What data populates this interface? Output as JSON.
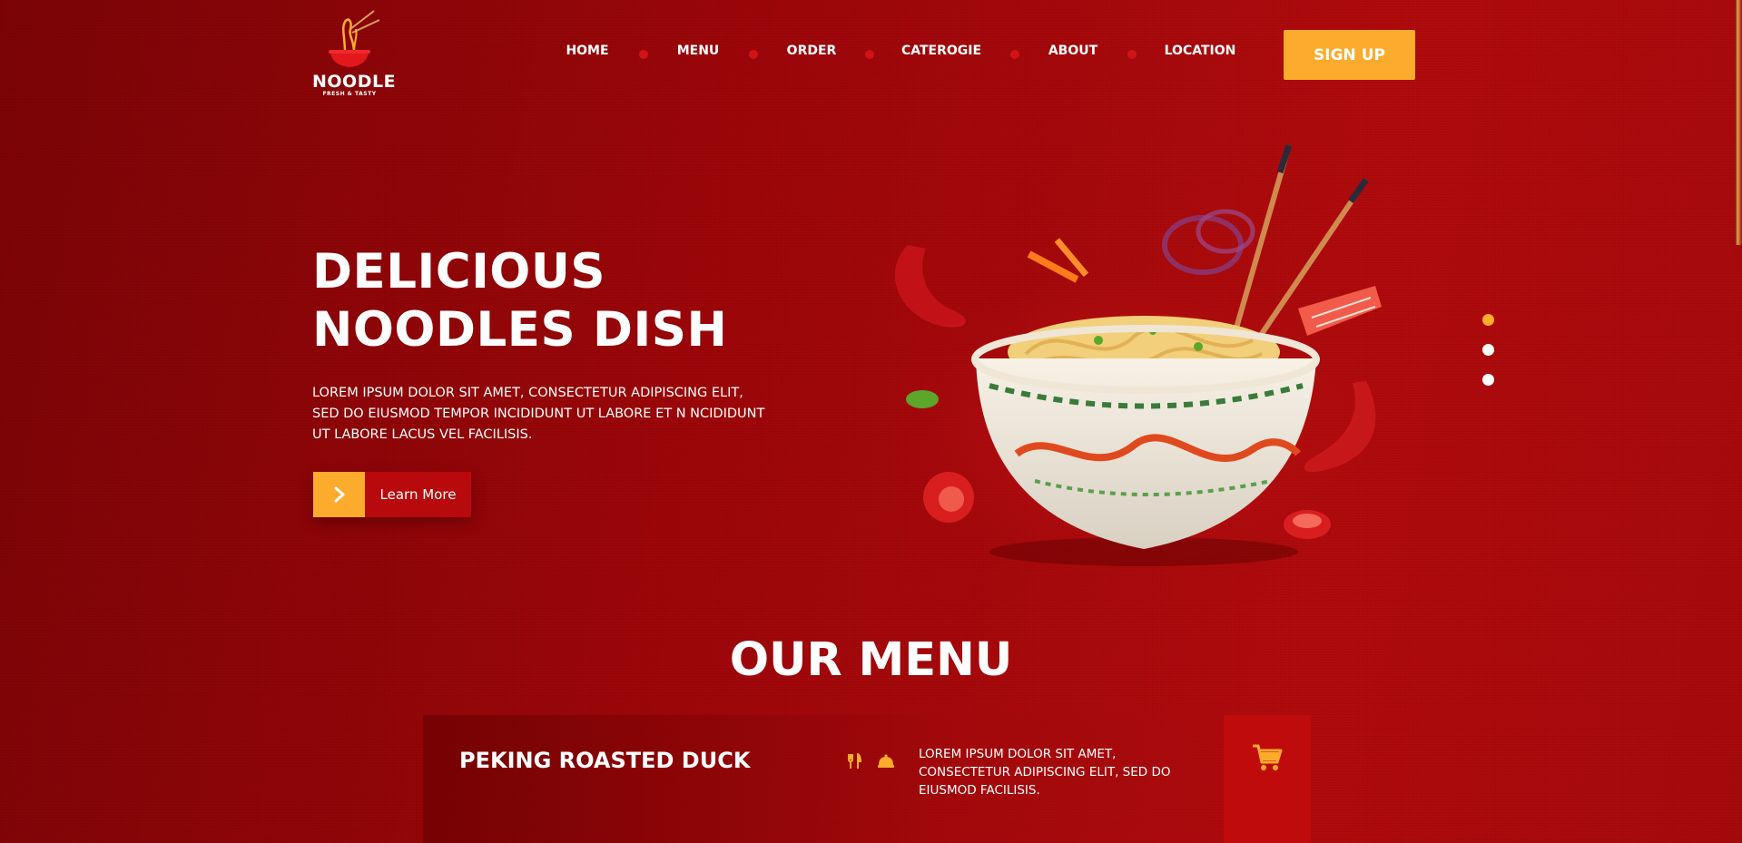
{
  "brand": {
    "name": "NOODLE",
    "tagline": "FRESH & TASTY"
  },
  "nav": {
    "items": [
      {
        "label": "HOME"
      },
      {
        "label": "MENU"
      },
      {
        "label": "ORDER"
      },
      {
        "label": "CATEROGIE"
      },
      {
        "label": "ABOUT"
      },
      {
        "label": "LOCATION"
      }
    ],
    "signup_label": "SIGN UP"
  },
  "hero": {
    "title_line1": "DELICIOUS",
    "title_line2": "NOODLES DISH",
    "description": "LOREM IPSUM DOLOR SIT AMET, CONSECTETUR ADIPISCING ELIT, SED DO EIUSMOD TEMPOR INCIDIDUNT UT LABORE ET N NCIDIDUNT UT LABORE LACUS VEL FACILISIS.",
    "cta_label": "Learn More"
  },
  "slider": {
    "count": 3,
    "active_index": 0
  },
  "menu": {
    "heading": "OUR MENU",
    "items": [
      {
        "name": "PEKING ROASTED DUCK",
        "description": "LOREM IPSUM DOLOR SIT AMET, CONSECTETUR ADIPISCING ELIT, SED DO EIUSMOD FACILISIS."
      }
    ]
  },
  "icons": {
    "logo": "noodle-bowl-icon",
    "cta": "chevron-right-icon",
    "menu_item_1": "fork-knife-icon",
    "menu_item_2": "dish-cover-icon",
    "cart": "shopping-cart-icon"
  },
  "colors": {
    "accent": "#fdab2c",
    "primary": "#b80a0c",
    "nav_dot": "#d11316",
    "background": "#9e0609"
  }
}
